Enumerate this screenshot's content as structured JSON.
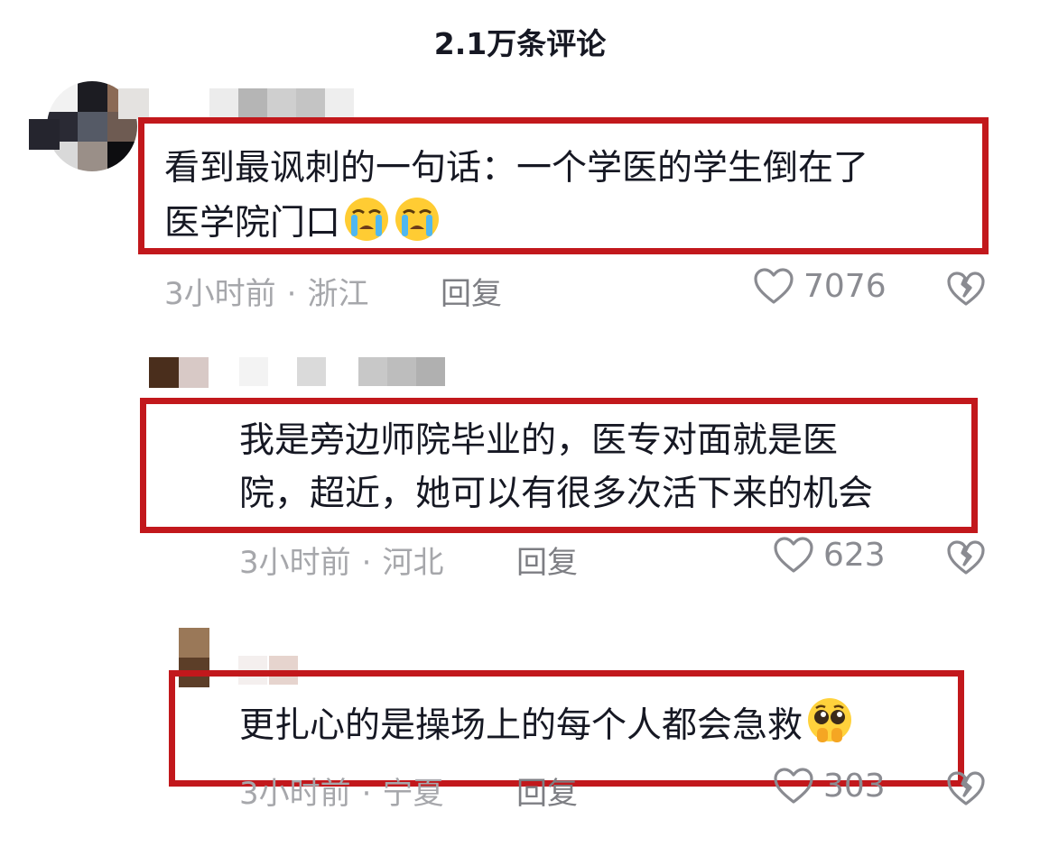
{
  "header": {
    "title": "2.1万条评论"
  },
  "colors": {
    "highlight": "#c2181c",
    "meta": "#a6a7ab",
    "count": "#8a8b91"
  },
  "comments": [
    {
      "lines": [
        "看到最讽刺的一句话：一个学医的学生倒在了",
        "医学院门口"
      ],
      "emoji": "loudly-crying-face-icon",
      "emoji_count": 2,
      "time": "3小时前",
      "separator": "·",
      "location": "浙江",
      "reply_label": "回复",
      "likes": "7076"
    },
    {
      "lines": [
        "我是旁边师院毕业的，医专对面就是医",
        "院，超近，她可以有很多次活下来的机会"
      ],
      "time": "3小时前",
      "separator": "·",
      "location": "河北",
      "reply_label": "回复",
      "likes": "623"
    },
    {
      "lines": [
        "更扎心的是操场上的每个人都会急救"
      ],
      "emoji": "pleading-face-icon",
      "emoji_count": 1,
      "time": "3小时前",
      "separator": "·",
      "location": "宁夏",
      "reply_label": "回复",
      "likes": "303"
    }
  ]
}
